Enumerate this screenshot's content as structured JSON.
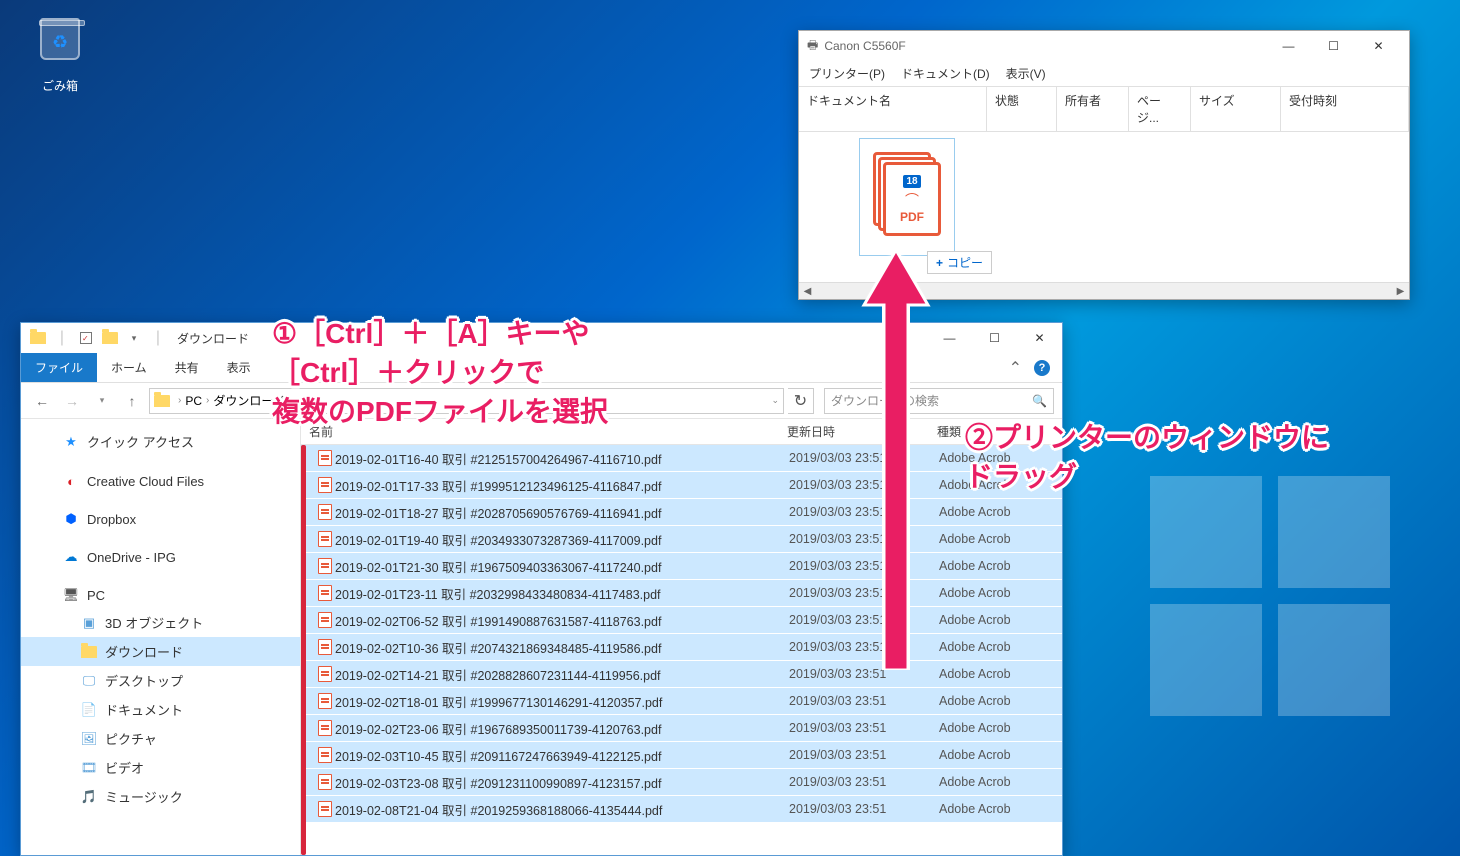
{
  "desktop": {
    "recycle_bin_label": "ごみ箱"
  },
  "printer_window": {
    "title": "Canon C5560F",
    "menu": {
      "printer": "プリンター(P)",
      "document": "ドキュメント(D)",
      "view": "表示(V)"
    },
    "columns": {
      "doc_name": "ドキュメント名",
      "status": "状態",
      "owner": "所有者",
      "pages": "ページ...",
      "size": "サイズ",
      "received": "受付時刻"
    },
    "drag_badge": "18",
    "drag_pdf_label": "PDF",
    "copy_label": "コピー"
  },
  "explorer": {
    "title": "ダウンロード",
    "ribbon": {
      "file": "ファイル",
      "home": "ホーム",
      "share": "共有",
      "view": "表示"
    },
    "breadcrumb": {
      "pc": "PC",
      "folder": "ダウンロード"
    },
    "search_placeholder": "ダウンロードの検索",
    "columns": {
      "name": "名前",
      "date": "更新日時",
      "type": "種類"
    },
    "sidebar": {
      "quick_access": "クイック アクセス",
      "creative_cloud": "Creative Cloud Files",
      "dropbox": "Dropbox",
      "onedrive": "OneDrive - IPG",
      "pc": "PC",
      "pc_items": {
        "objects3d": "3D オブジェクト",
        "downloads": "ダウンロード",
        "desktop": "デスクトップ",
        "documents": "ドキュメント",
        "pictures": "ピクチャ",
        "videos": "ビデオ",
        "music": "ミュージック"
      }
    },
    "files": [
      {
        "name": "2019-02-01T16-40 取引 #2125157004264967-4116710.pdf",
        "date": "2019/03/03 23:51",
        "type": "Adobe Acrob"
      },
      {
        "name": "2019-02-01T17-33 取引 #1999512123496125-4116847.pdf",
        "date": "2019/03/03 23:51",
        "type": "Adobe Acrob"
      },
      {
        "name": "2019-02-01T18-27 取引 #2028705690576769-4116941.pdf",
        "date": "2019/03/03 23:51",
        "type": "Adobe Acrob"
      },
      {
        "name": "2019-02-01T19-40 取引 #2034933073287369-4117009.pdf",
        "date": "2019/03/03 23:51",
        "type": "Adobe Acrob"
      },
      {
        "name": "2019-02-01T21-30 取引 #1967509403363067-4117240.pdf",
        "date": "2019/03/03 23:51",
        "type": "Adobe Acrob"
      },
      {
        "name": "2019-02-01T23-11 取引 #2032998433480834-4117483.pdf",
        "date": "2019/03/03 23:51",
        "type": "Adobe Acrob"
      },
      {
        "name": "2019-02-02T06-52 取引 #1991490887631587-4118763.pdf",
        "date": "2019/03/03 23:51",
        "type": "Adobe Acrob"
      },
      {
        "name": "2019-02-02T10-36 取引 #2074321869348485-4119586.pdf",
        "date": "2019/03/03 23:51",
        "type": "Adobe Acrob"
      },
      {
        "name": "2019-02-02T14-21 取引 #2028828607231144-4119956.pdf",
        "date": "2019/03/03 23:51",
        "type": "Adobe Acrob"
      },
      {
        "name": "2019-02-02T18-01 取引 #1999677130146291-4120357.pdf",
        "date": "2019/03/03 23:51",
        "type": "Adobe Acrob"
      },
      {
        "name": "2019-02-02T23-06 取引 #1967689350011739-4120763.pdf",
        "date": "2019/03/03 23:51",
        "type": "Adobe Acrob"
      },
      {
        "name": "2019-02-03T10-45 取引 #2091167247663949-4122125.pdf",
        "date": "2019/03/03 23:51",
        "type": "Adobe Acrob"
      },
      {
        "name": "2019-02-03T23-08 取引 #2091231100990897-4123157.pdf",
        "date": "2019/03/03 23:51",
        "type": "Adobe Acrob"
      },
      {
        "name": "2019-02-08T21-04 取引 #2019259368188066-4135444.pdf",
        "date": "2019/03/03 23:51",
        "type": "Adobe Acrob"
      }
    ]
  },
  "annotations": {
    "a1_l1": "①［Ctrl］＋［A］キーや",
    "a1_l2": "［Ctrl］＋クリックで",
    "a1_l3": "複数のPDFファイルを選択",
    "a2_l1": "②プリンターのウィンドウに",
    "a2_l2": "ドラッグ"
  }
}
